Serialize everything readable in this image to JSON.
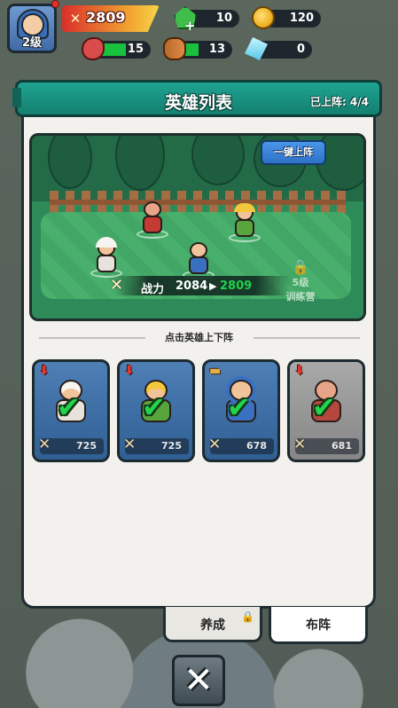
{
  "player": {
    "level": "2级",
    "power": "2809"
  },
  "resources": {
    "gems": "10",
    "coins": "120",
    "meat": "15",
    "wood": "13",
    "crystal": "0",
    "meat_fill": 0.6,
    "wood_fill": 0.4
  },
  "panel": {
    "title": "英雄列表",
    "deployed": "已上阵: 4/4",
    "one_click": "一键上阵",
    "locked_slot": "5级\n训练营",
    "power_label": "战力",
    "power_old": "2084",
    "power_new": "2809",
    "hint": "点击英雄上下阵"
  },
  "heroes": [
    {
      "power": "725",
      "badge": "down-arrow",
      "selected": true
    },
    {
      "power": "725",
      "badge": "down-arrow",
      "selected": true
    },
    {
      "power": "678",
      "badge": "book",
      "selected": true
    },
    {
      "power": "681",
      "badge": "down-arrow",
      "selected": true
    }
  ],
  "tabs": {
    "cultivate": "养成",
    "formation": "布阵"
  },
  "icons": [
    "swords-icon",
    "gem-plus-icon",
    "coin-icon",
    "meat-icon",
    "wood-icon",
    "crystal-icon",
    "lock-icon",
    "close-icon",
    "check-icon",
    "down-arrow-icon",
    "book-icon"
  ]
}
